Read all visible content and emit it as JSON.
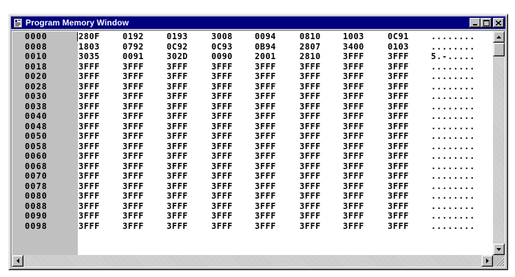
{
  "window": {
    "title": "Program Memory Window",
    "icon": "window-app-icon",
    "buttons": [
      "minimize-icon",
      "maximize-icon",
      "close-icon"
    ]
  },
  "memory": {
    "rows": [
      {
        "addr": "0000",
        "words": [
          "280F",
          "0192",
          "0193",
          "3008",
          "0094",
          "0810",
          "1003",
          "0C91"
        ],
        "ascii": "........"
      },
      {
        "addr": "0008",
        "words": [
          "1803",
          "0792",
          "0C92",
          "0C93",
          "0B94",
          "2807",
          "3400",
          "0103"
        ],
        "ascii": "........"
      },
      {
        "addr": "0010",
        "words": [
          "3035",
          "0091",
          "302D",
          "0090",
          "2001",
          "2810",
          "3FFF",
          "3FFF"
        ],
        "ascii": "5.-....."
      },
      {
        "addr": "0018",
        "words": [
          "3FFF",
          "3FFF",
          "3FFF",
          "3FFF",
          "3FFF",
          "3FFF",
          "3FFF",
          "3FFF"
        ],
        "ascii": "........"
      },
      {
        "addr": "0020",
        "words": [
          "3FFF",
          "3FFF",
          "3FFF",
          "3FFF",
          "3FFF",
          "3FFF",
          "3FFF",
          "3FFF"
        ],
        "ascii": "........"
      },
      {
        "addr": "0028",
        "words": [
          "3FFF",
          "3FFF",
          "3FFF",
          "3FFF",
          "3FFF",
          "3FFF",
          "3FFF",
          "3FFF"
        ],
        "ascii": "........"
      },
      {
        "addr": "0030",
        "words": [
          "3FFF",
          "3FFF",
          "3FFF",
          "3FFF",
          "3FFF",
          "3FFF",
          "3FFF",
          "3FFF"
        ],
        "ascii": "........"
      },
      {
        "addr": "0038",
        "words": [
          "3FFF",
          "3FFF",
          "3FFF",
          "3FFF",
          "3FFF",
          "3FFF",
          "3FFF",
          "3FFF"
        ],
        "ascii": "........"
      },
      {
        "addr": "0040",
        "words": [
          "3FFF",
          "3FFF",
          "3FFF",
          "3FFF",
          "3FFF",
          "3FFF",
          "3FFF",
          "3FFF"
        ],
        "ascii": "........"
      },
      {
        "addr": "0048",
        "words": [
          "3FFF",
          "3FFF",
          "3FFF",
          "3FFF",
          "3FFF",
          "3FFF",
          "3FFF",
          "3FFF"
        ],
        "ascii": "........"
      },
      {
        "addr": "0050",
        "words": [
          "3FFF",
          "3FFF",
          "3FFF",
          "3FFF",
          "3FFF",
          "3FFF",
          "3FFF",
          "3FFF"
        ],
        "ascii": "........"
      },
      {
        "addr": "0058",
        "words": [
          "3FFF",
          "3FFF",
          "3FFF",
          "3FFF",
          "3FFF",
          "3FFF",
          "3FFF",
          "3FFF"
        ],
        "ascii": "........"
      },
      {
        "addr": "0060",
        "words": [
          "3FFF",
          "3FFF",
          "3FFF",
          "3FFF",
          "3FFF",
          "3FFF",
          "3FFF",
          "3FFF"
        ],
        "ascii": "........"
      },
      {
        "addr": "0068",
        "words": [
          "3FFF",
          "3FFF",
          "3FFF",
          "3FFF",
          "3FFF",
          "3FFF",
          "3FFF",
          "3FFF"
        ],
        "ascii": "........"
      },
      {
        "addr": "0070",
        "words": [
          "3FFF",
          "3FFF",
          "3FFF",
          "3FFF",
          "3FFF",
          "3FFF",
          "3FFF",
          "3FFF"
        ],
        "ascii": "........"
      },
      {
        "addr": "0078",
        "words": [
          "3FFF",
          "3FFF",
          "3FFF",
          "3FFF",
          "3FFF",
          "3FFF",
          "3FFF",
          "3FFF"
        ],
        "ascii": "........"
      },
      {
        "addr": "0080",
        "words": [
          "3FFF",
          "3FFF",
          "3FFF",
          "3FFF",
          "3FFF",
          "3FFF",
          "3FFF",
          "3FFF"
        ],
        "ascii": "........"
      },
      {
        "addr": "0088",
        "words": [
          "3FFF",
          "3FFF",
          "3FFF",
          "3FFF",
          "3FFF",
          "3FFF",
          "3FFF",
          "3FFF"
        ],
        "ascii": "........"
      },
      {
        "addr": "0090",
        "words": [
          "3FFF",
          "3FFF",
          "3FFF",
          "3FFF",
          "3FFF",
          "3FFF",
          "3FFF",
          "3FFF"
        ],
        "ascii": "........"
      },
      {
        "addr": "0098",
        "words": [
          "3FFF",
          "3FFF",
          "3FFF",
          "3FFF",
          "3FFF",
          "3FFF",
          "3FFF",
          "3FFF"
        ],
        "ascii": "........"
      }
    ]
  },
  "scrollbars": {
    "vertical": {
      "up": "scroll-up-arrow-icon",
      "down": "scroll-down-arrow-icon"
    },
    "horizontal": {
      "left": "scroll-left-arrow-icon",
      "right": "scroll-right-arrow-icon"
    }
  }
}
